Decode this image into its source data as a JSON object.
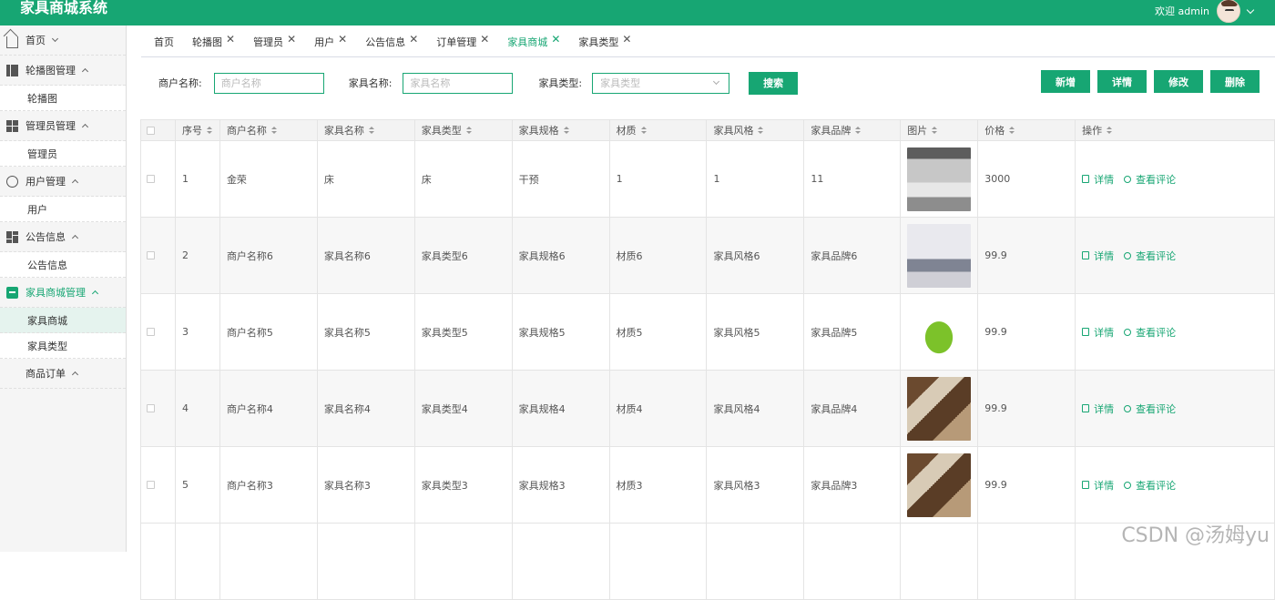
{
  "app": {
    "title": "家具商城系统",
    "welcome": "欢迎 admin"
  },
  "colors": {
    "accent": "#17a673",
    "header_bg": "#17a673"
  },
  "sidebar": {
    "groups": [
      {
        "label": "首页",
        "icon": "home-icon",
        "items": []
      },
      {
        "label": "轮播图管理",
        "icon": "columns-icon",
        "items": [
          "轮播图"
        ]
      },
      {
        "label": "管理员管理",
        "icon": "grid-icon",
        "items": [
          "管理员"
        ]
      },
      {
        "label": "用户管理",
        "icon": "badge-icon",
        "items": [
          "用户"
        ]
      },
      {
        "label": "公告信息",
        "icon": "dashboard-icon",
        "items": [
          "公告信息"
        ]
      },
      {
        "label": "家具商城管理",
        "icon": "box-icon",
        "items": [
          "家具商城",
          "家具类型"
        ]
      },
      {
        "label": "商品订单",
        "icon": "",
        "items": []
      }
    ]
  },
  "tabs": [
    {
      "label": "首页",
      "closable": false
    },
    {
      "label": "轮播图",
      "closable": true
    },
    {
      "label": "管理员",
      "closable": true
    },
    {
      "label": "用户",
      "closable": true
    },
    {
      "label": "公告信息",
      "closable": true
    },
    {
      "label": "订单管理",
      "closable": true
    },
    {
      "label": "家具商城",
      "closable": true,
      "active": true
    },
    {
      "label": "家具类型",
      "closable": true
    }
  ],
  "tab_close": "✕",
  "search": {
    "merchant_label": "商户名称:",
    "merchant_placeholder": "商户名称",
    "name_label": "家具名称:",
    "name_placeholder": "家具名称",
    "type_label": "家具类型:",
    "type_placeholder": "家具类型",
    "search_button": "搜索"
  },
  "toolbar": {
    "add": "新增",
    "detail": "详情",
    "edit": "修改",
    "delete": "删除"
  },
  "table": {
    "columns": [
      "序号",
      "商户名称",
      "家具名称",
      "家具类型",
      "家具规格",
      "材质",
      "家具风格",
      "家具品牌",
      "图片",
      "价格",
      "操作"
    ],
    "detail_link": "详情",
    "review_link": "查看评论",
    "rows": [
      {
        "no": "1",
        "merchant": "金荣",
        "name": "床",
        "type": "床",
        "spec": "干预",
        "material": "1",
        "style": "1",
        "brand": "11",
        "image": "bedroom-white",
        "price": "3000"
      },
      {
        "no": "2",
        "merchant": "商户名称6",
        "name": "家具名称6",
        "type": "家具类型6",
        "spec": "家具规格6",
        "material": "材质6",
        "style": "家具风格6",
        "brand": "家具品牌6",
        "image": "bedroom-gray",
        "price": "99.9"
      },
      {
        "no": "3",
        "merchant": "商户名称5",
        "name": "家具名称5",
        "type": "家具类型5",
        "spec": "家具规格5",
        "material": "材质5",
        "style": "家具风格5",
        "brand": "家具品牌5",
        "image": "green-sofa",
        "price": "99.9"
      },
      {
        "no": "4",
        "merchant": "商户名称4",
        "name": "家具名称4",
        "type": "家具类型4",
        "spec": "家具规格4",
        "material": "材质4",
        "style": "家具风格4",
        "brand": "家具品牌4",
        "image": "dining-room",
        "price": "99.9"
      },
      {
        "no": "5",
        "merchant": "商户名称3",
        "name": "家具名称3",
        "type": "家具类型3",
        "spec": "家具规格3",
        "material": "材质3",
        "style": "家具风格3",
        "brand": "家具品牌3",
        "image": "dining-room",
        "price": "99.9"
      }
    ]
  },
  "watermark": "CSDN @汤姆yu"
}
